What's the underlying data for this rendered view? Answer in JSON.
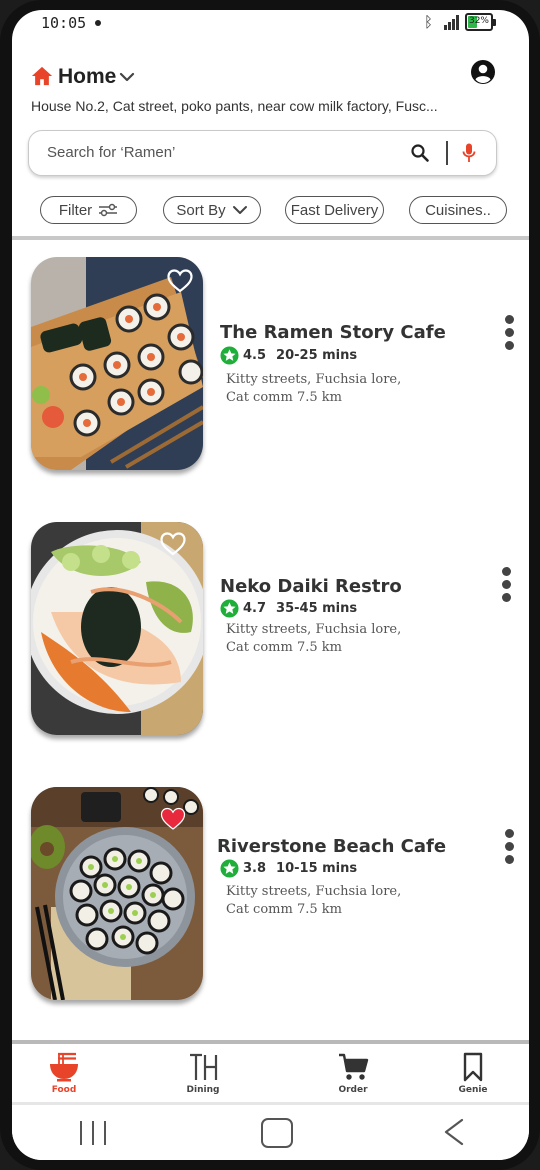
{
  "status_bar": {
    "time": "10:05",
    "battery": "32%"
  },
  "header": {
    "location_label": "Home",
    "address": "House No.2, Cat street, poko pants, near cow milk factory, Fusc..."
  },
  "search": {
    "placeholder": "Search for ‘Ramen’"
  },
  "filters": {
    "filter": "Filter",
    "sort_by": "Sort By",
    "fast_delivery": "Fast Delivery",
    "cuisines": "Cuisines.."
  },
  "restaurants": [
    {
      "name": "The Ramen Story Cafe",
      "rating": "4.5",
      "eta": "20-25 mins",
      "address_line1": "Kitty streets, Fuchsia lore,",
      "address_line2": "Cat comm  7.5 km",
      "favorite": false
    },
    {
      "name": "Neko Daiki Restro",
      "rating": "4.7",
      "eta": "35-45 mins",
      "address_line1": "Kitty streets, Fuchsia lore,",
      "address_line2": "Cat comm  7.5 km",
      "favorite": false
    },
    {
      "name": "Riverstone Beach Cafe",
      "rating": "3.8",
      "eta": "10-15  mins",
      "address_line1": "Kitty streets, Fuchsia lore,",
      "address_line2": "Cat comm  7.5 km",
      "favorite": true
    }
  ],
  "bottom_nav": {
    "food": "Food",
    "dining": "Dining",
    "order": "Order",
    "genie": "Genie"
  },
  "colors": {
    "accent": "#e8442a",
    "rating_green": "#1fae3a",
    "favorite_red": "#e8283c"
  }
}
